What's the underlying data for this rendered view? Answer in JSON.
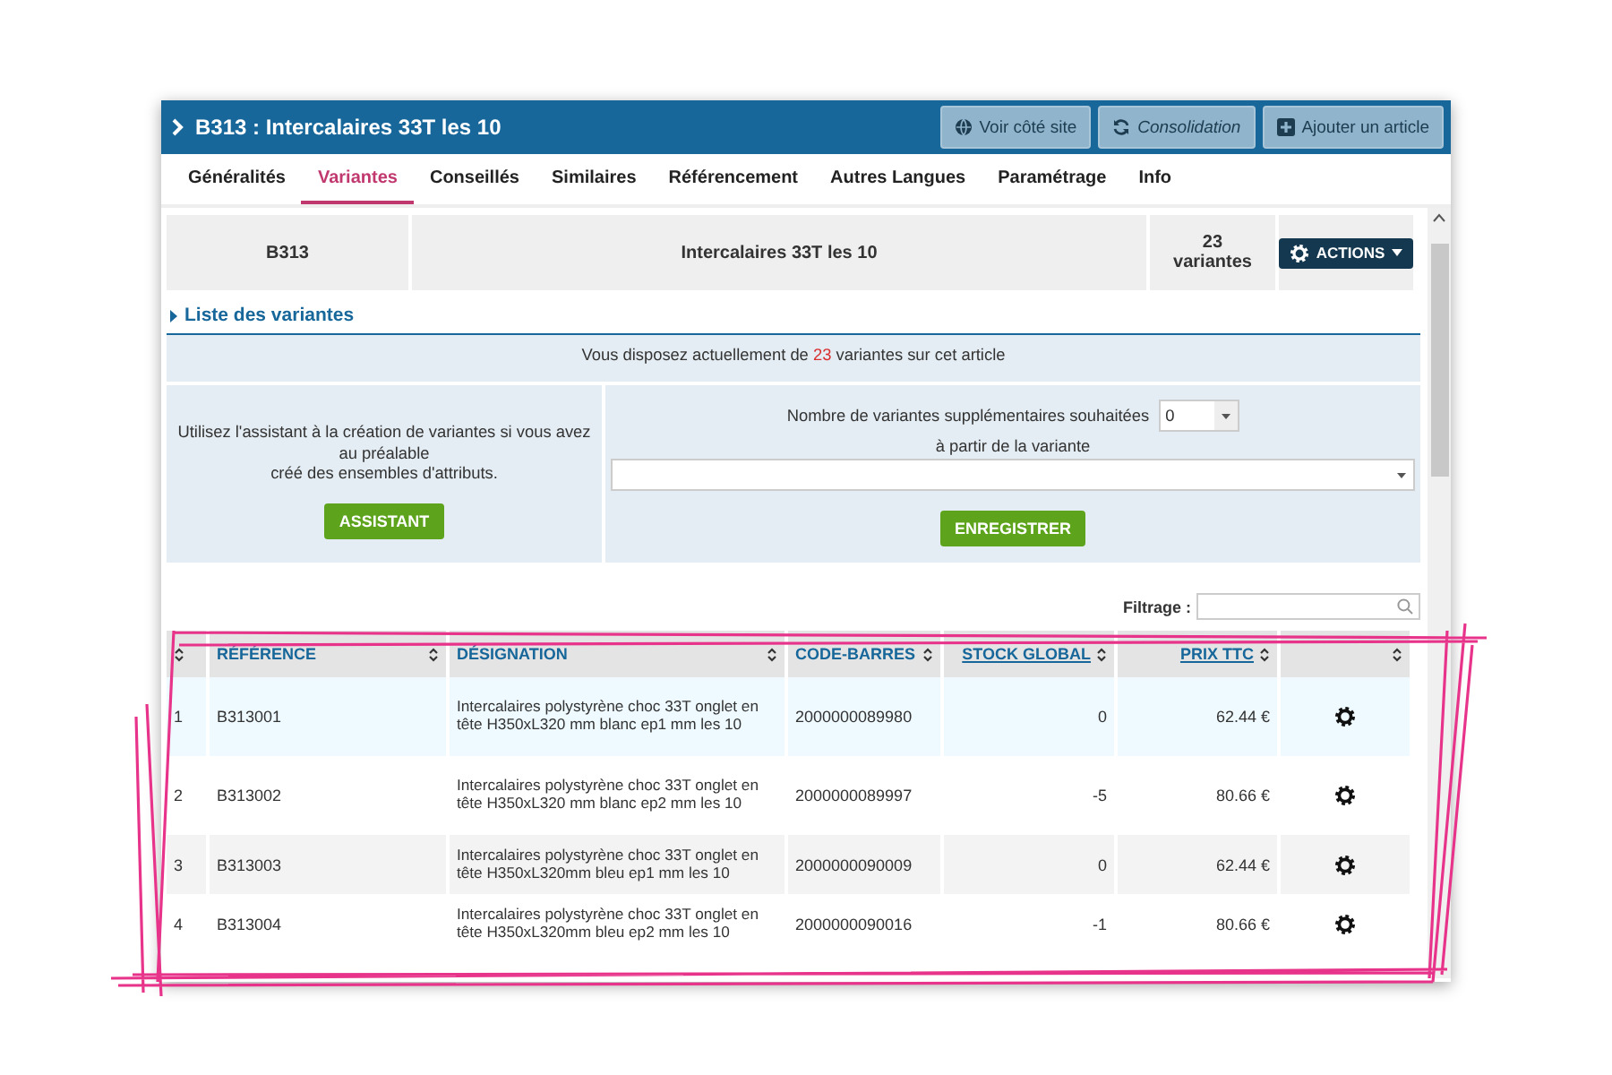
{
  "header": {
    "title": "B313 : Intercalaires 33T les 10",
    "buttons": [
      {
        "kind": "globe",
        "label": "Voir côté site"
      },
      {
        "kind": "refresh",
        "label": "Consolidation"
      },
      {
        "kind": "plus",
        "label": "Ajouter un article"
      }
    ]
  },
  "tabs": [
    {
      "label": "Généralités",
      "selected": false
    },
    {
      "label": "Variantes",
      "selected": true
    },
    {
      "label": "Conseillés",
      "selected": false
    },
    {
      "label": "Similaires",
      "selected": false
    },
    {
      "label": "Référencement",
      "selected": false
    },
    {
      "label": "Autres Langues",
      "selected": false
    },
    {
      "label": "Paramétrage",
      "selected": false
    },
    {
      "label": "Info",
      "selected": false
    }
  ],
  "summary": {
    "reference": "B313",
    "name": "Intercalaires 33T les 10",
    "count": "23",
    "count_label": "variantes",
    "actions_button": "ACTIONS"
  },
  "section_title": "Liste des variantes",
  "info": {
    "before": "Vous disposez actuellement de",
    "count": "23",
    "after": "variantes sur cet article"
  },
  "assistant": {
    "lines": [
      "Utilisez l'assistant à la création de variantes si vous avez au préalable",
      "créé des ensembles d'attributs."
    ],
    "button": "ASSISTANT"
  },
  "create": {
    "count_label": "Nombre de variantes supplémentaires souhaitées",
    "count_value": "0",
    "from_label": "à partir de la variante",
    "button": "ENREGISTRER"
  },
  "filter": {
    "label": "Filtrage :"
  },
  "table": {
    "columns": [
      {
        "kind": "index"
      },
      {
        "label": "RÉFÉRENCE",
        "link": false
      },
      {
        "label": "DÉSIGNATION",
        "link": false
      },
      {
        "label": "CODE-BARRES",
        "link": false
      },
      {
        "label": "STOCK GLOBAL",
        "link": true
      },
      {
        "label": "PRIX TTC",
        "link": true
      },
      {
        "kind": "actions"
      }
    ],
    "rows": [
      {
        "num": "1",
        "reference": "B313001",
        "designation": "Intercalaires polystyrène choc 33T onglet en tête H350xL320 mm blanc ep1 mm les 10",
        "barcode": "2000000089980",
        "stock": "0",
        "price": "62.44 €",
        "selected": true
      },
      {
        "num": "2",
        "reference": "B313002",
        "designation": "Intercalaires polystyrène choc 33T onglet en tête H350xL320 mm blanc ep2 mm les 10",
        "barcode": "2000000089997",
        "stock": "-5",
        "price": "80.66 €",
        "selected": false
      },
      {
        "num": "3",
        "reference": "B313003",
        "designation": "Intercalaires polystyrène choc 33T onglet en tête H350xL320mm bleu ep1 mm les 10",
        "barcode": "2000000090009",
        "stock": "0",
        "price": "62.44 €",
        "selected": false
      },
      {
        "num": "4",
        "reference": "B313004",
        "designation": "Intercalaires polystyrène choc 33T onglet en tête H350xL320mm bleu ep2 mm les 10",
        "barcode": "2000000090016",
        "stock": "-1",
        "price": "80.66 €",
        "selected": false
      }
    ]
  }
}
